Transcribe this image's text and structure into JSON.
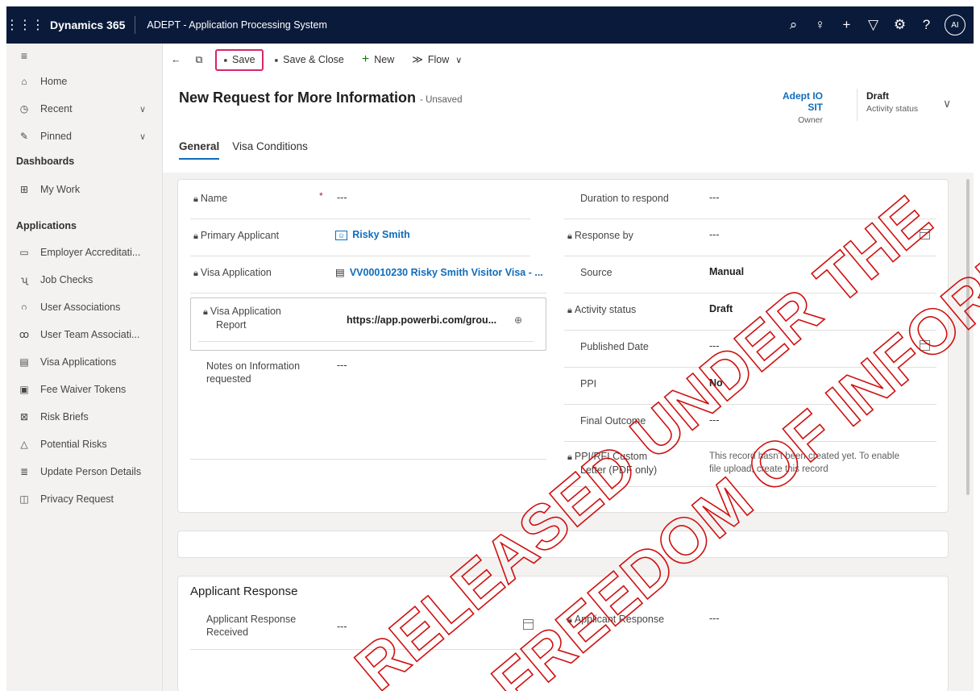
{
  "topbar": {
    "brand": "Dynamics 365",
    "app_title": "ADEPT - Application Processing System",
    "avatar": "AI"
  },
  "sidebar": {
    "items_top": [
      {
        "label": "Home",
        "icon": "home-icon",
        "chev": false
      },
      {
        "label": "Recent",
        "icon": "clock-icon",
        "chev": true
      },
      {
        "label": "Pinned",
        "icon": "pin-icon",
        "chev": true
      }
    ],
    "dashboards_label": "Dashboards",
    "dashboards": [
      {
        "label": "My Work",
        "icon": "grid-icon"
      }
    ],
    "applications_label": "Applications",
    "applications": [
      {
        "label": "Employer Accreditati...",
        "icon": "document-icon"
      },
      {
        "label": "Job Checks",
        "icon": "check-icon"
      },
      {
        "label": "User Associations",
        "icon": "people-icon"
      },
      {
        "label": "User Team Associati...",
        "icon": "team-icon"
      },
      {
        "label": "Visa Applications",
        "icon": "clipboard-icon"
      },
      {
        "label": "Fee Waiver Tokens",
        "icon": "token-icon"
      },
      {
        "label": "Risk Briefs",
        "icon": "brief-icon"
      },
      {
        "label": "Potential Risks",
        "icon": "warning-icon"
      },
      {
        "label": "Update Person Details",
        "icon": "person-list-icon"
      },
      {
        "label": "Privacy Request",
        "icon": "privacy-icon"
      }
    ]
  },
  "commandbar": {
    "save": "Save",
    "save_close": "Save & Close",
    "new": "New",
    "flow": "Flow"
  },
  "header": {
    "title": "New Request for More Information",
    "unsaved": "- Unsaved",
    "owner_value": "Adept IO SIT",
    "owner_label": "Owner",
    "status_value": "Draft",
    "status_label": "Activity status"
  },
  "tabs": [
    "General",
    "Visa Conditions"
  ],
  "left_fields": {
    "name_label": "Name",
    "name_value": "---",
    "primary_applicant_label": "Primary Applicant",
    "primary_applicant_value": "Risky Smith",
    "visa_application_label": "Visa Application",
    "visa_application_value": "VV00010230 Risky Smith Visitor Visa - ...",
    "visa_report_label_1": "Visa Application",
    "visa_report_label_2": "Report",
    "visa_report_value": "https://app.powerbi.com/grou...",
    "notes_label_1": "Notes on Information",
    "notes_label_2": "requested",
    "notes_value": "---"
  },
  "right_fields": {
    "duration_label": "Duration to respond",
    "duration_value": "---",
    "response_by_label": "Response by",
    "response_by_value": "---",
    "source_label": "Source",
    "source_value": "Manual",
    "activity_status_label": "Activity status",
    "activity_status_value": "Draft",
    "published_label": "Published Date",
    "published_value": "---",
    "ppi_label": "PPI",
    "ppi_value": "No",
    "final_outcome_label": "Final Outcome",
    "final_outcome_value": "---",
    "letter_label_1": "PPI/RFI Custom",
    "letter_label_2": "Letter (PDF only)",
    "letter_value_1": "This record hasn't been created yet. To enable",
    "letter_value_2": "file upload, create this record"
  },
  "applicant_response": {
    "title": "Applicant Response",
    "received_label_1": "Applicant Response",
    "received_label_2": "Received",
    "received_value": "---",
    "response_label": "Applicant Response",
    "response_value": "---"
  },
  "watermark": {
    "line1": "RELEASED UNDER THE",
    "line2": "FREEDOM OF INFORMATION ACT"
  }
}
